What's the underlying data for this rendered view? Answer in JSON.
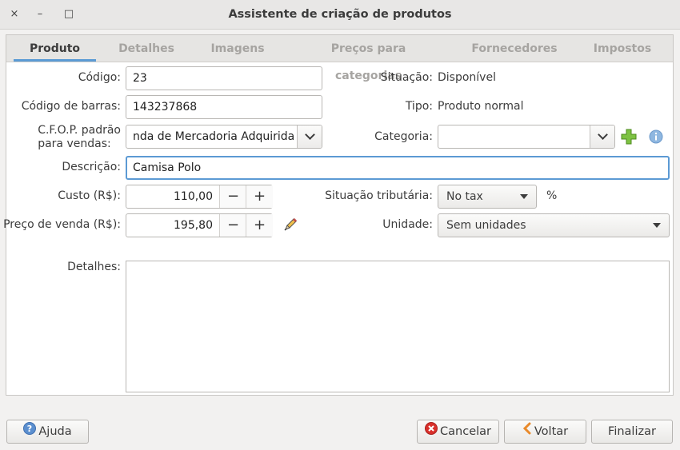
{
  "window": {
    "title": "Assistente de criação de produtos",
    "close_glyph": "×",
    "minimize_glyph": "–",
    "maximize_glyph": "□"
  },
  "tabs": [
    {
      "label": "Produto",
      "active": true
    },
    {
      "label": "Detalhes",
      "active": false
    },
    {
      "label": "Imagens",
      "active": false
    },
    {
      "label": "Preços para categorias",
      "active": false
    },
    {
      "label": "Fornecedores",
      "active": false
    },
    {
      "label": "Impostos",
      "active": false
    }
  ],
  "form": {
    "codigo": {
      "label": "Código:",
      "value": "23"
    },
    "codigo_barras": {
      "label": "Código de barras:",
      "value": "143237868"
    },
    "cfop": {
      "label_line1": "C.F.O.P. padrão",
      "label_line2": "para vendas:",
      "value": "nda de Mercadoria Adquirida"
    },
    "descricao": {
      "label": "Descrição:",
      "value": "Camisa Polo"
    },
    "custo": {
      "label": "Custo (R$):",
      "value": "110,00"
    },
    "preco_venda": {
      "label": "Preço de venda (R$):",
      "value": "195,80"
    },
    "situacao": {
      "label": "Situação:",
      "value": "Disponível"
    },
    "tipo": {
      "label": "Tipo:",
      "value": "Produto normal"
    },
    "categoria": {
      "label": "Categoria:",
      "value": ""
    },
    "situacao_tributaria": {
      "label": "Situação tributária:",
      "value": "No tax",
      "suffix": "%"
    },
    "unidade": {
      "label": "Unidade:",
      "value": "Sem unidades"
    },
    "detalhes": {
      "label": "Detalhes:",
      "value": ""
    },
    "spin_minus": "−",
    "spin_plus": "+"
  },
  "icons": {
    "add_category": "plus-icon",
    "info": "info-icon",
    "edit_price": "pencil-icon",
    "help": "question-icon",
    "cancel": "cancel-icon",
    "back": "chevron-left-icon"
  },
  "colors": {
    "focus": "#5c9ad4",
    "tab_underline": "#5b9bd5",
    "add_green": "#7dc242",
    "info_blue": "#8fb7e0",
    "cancel_red": "#d9302b",
    "back_orange": "#e98a2b"
  },
  "buttons": {
    "help": "Ajuda",
    "cancel": "Cancelar",
    "back": "Voltar",
    "finish": "Finalizar"
  }
}
